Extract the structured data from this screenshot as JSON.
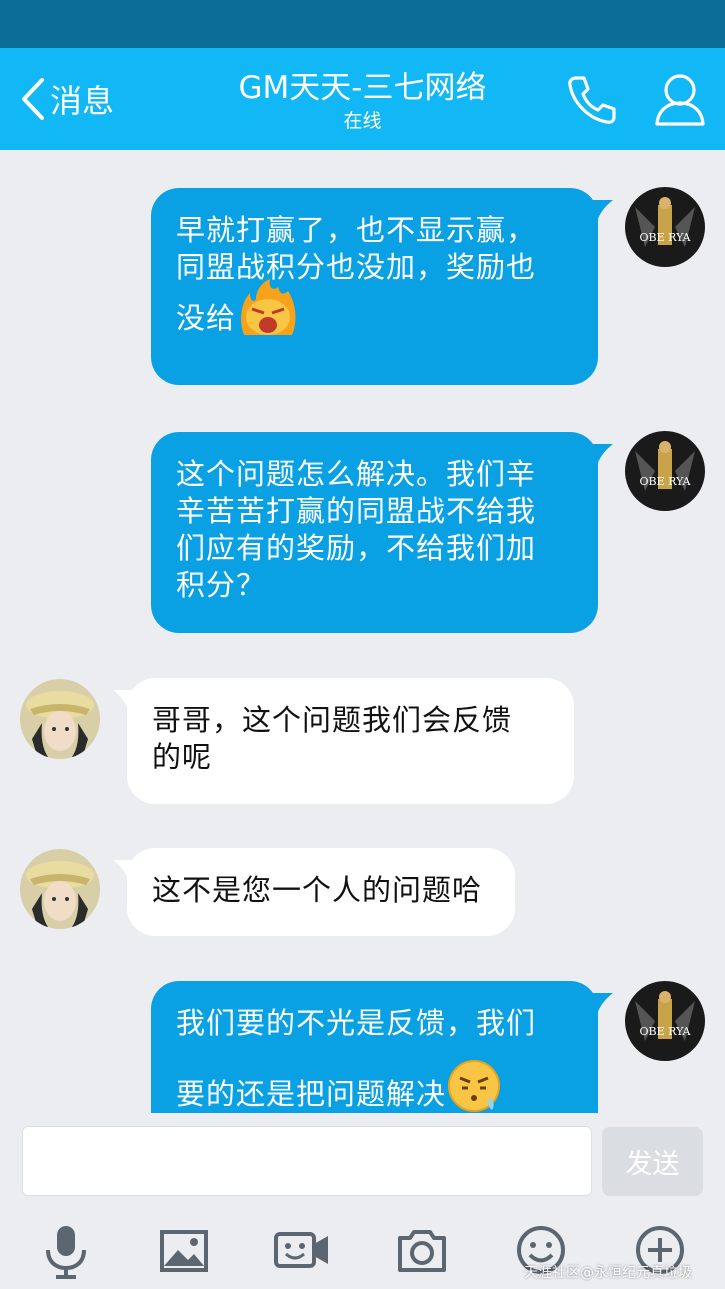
{
  "header": {
    "back_label": "消息",
    "title": "GM天天-三七网络",
    "status": "在线"
  },
  "messages": [
    {
      "direction": "out",
      "lines": [
        "早就打赢了，也不显示赢，",
        "同盟战积分也没加，奖励也",
        "没给"
      ],
      "emoji": "angry-fire-emoji"
    },
    {
      "direction": "out",
      "lines": [
        "这个问题怎么解决。我们辛",
        "辛苦苦打赢的同盟战不给我",
        "们应有的奖励，不给我们加",
        "积分？"
      ]
    },
    {
      "direction": "in",
      "lines": [
        "哥哥，这个问题我们会反馈",
        "的呢"
      ]
    },
    {
      "direction": "in",
      "lines": [
        "这不是您一个人的问题哈"
      ]
    },
    {
      "direction": "out",
      "lines": [
        "我们要的不光是反馈，我们",
        "要的还是把问题解决"
      ],
      "emoji": "sweat-face-emoji"
    }
  ],
  "avatar_self_text": "OBE RYA",
  "composer": {
    "placeholder": "",
    "send_label": "发送"
  },
  "toolbar_icons": [
    "microphone-icon",
    "image-icon",
    "video-call-icon",
    "camera-icon",
    "emoji-icon",
    "plus-icon"
  ],
  "watermark": "天涯社区@永恒纪元真垃圾",
  "colors": {
    "statusbar": "#0b6e97",
    "header": "#12b7f5",
    "out_bubble": "#0aa1e4",
    "in_bubble": "#ffffff",
    "background": "#ebedf1"
  }
}
